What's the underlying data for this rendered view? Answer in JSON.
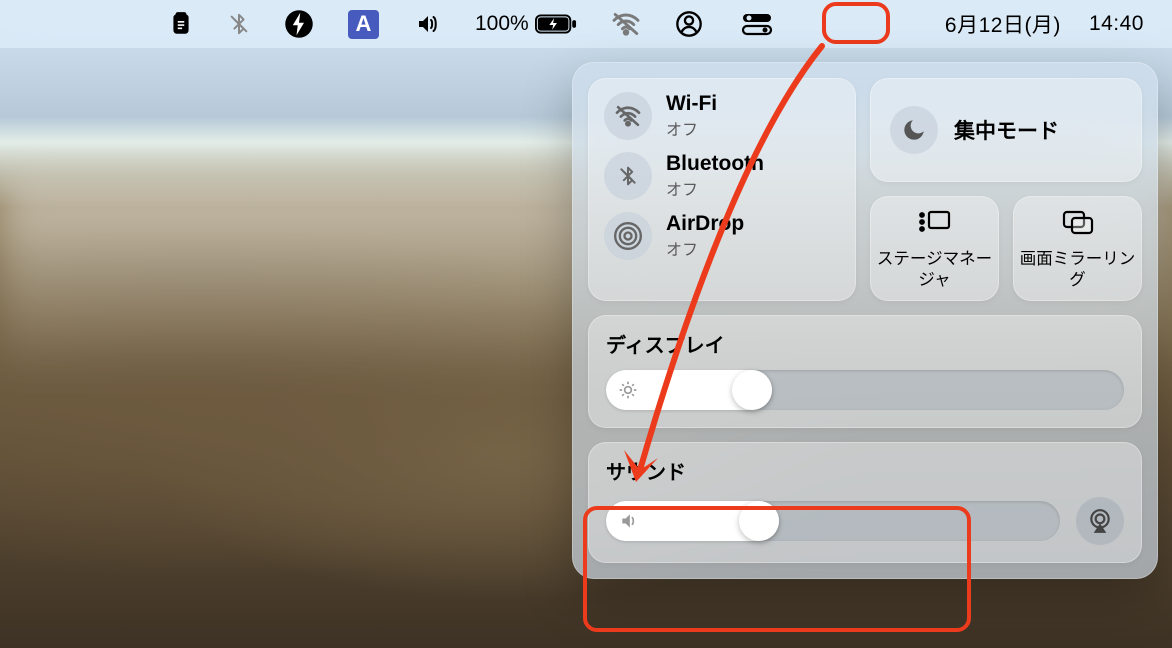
{
  "menubar": {
    "clipboard_icon": "clipboard-icon",
    "bluetooth_off_icon": "bluetooth-off-icon",
    "bolt_icon": "bolt-icon",
    "input_indicator": "A",
    "volume_icon": "volume-icon",
    "battery_percent": "100%",
    "battery_icon": "battery-charging-icon",
    "wifi_off_icon": "wifi-off-icon",
    "user_icon": "user-icon",
    "control_center_icon": "control-center-icon",
    "date": "6月12日(月)",
    "time": "14:40"
  },
  "control_center": {
    "wifi": {
      "title": "Wi-Fi",
      "status": "オフ"
    },
    "bluetooth": {
      "title": "Bluetooth",
      "status": "オフ"
    },
    "airdrop": {
      "title": "AirDrop",
      "status": "オフ"
    },
    "focus": {
      "title": "集中モード"
    },
    "stage_manager": {
      "label": "ステージマネージャ"
    },
    "screen_mirroring": {
      "label": "画面ミラーリング"
    },
    "display": {
      "title": "ディスプレイ",
      "value_percent": 30
    },
    "sound": {
      "title": "サウンド",
      "value_percent": 35
    }
  },
  "annotations": {
    "cc_menubar_highlight": true,
    "arrow_from_cc_to_sound": true,
    "sound_highlight": true
  }
}
